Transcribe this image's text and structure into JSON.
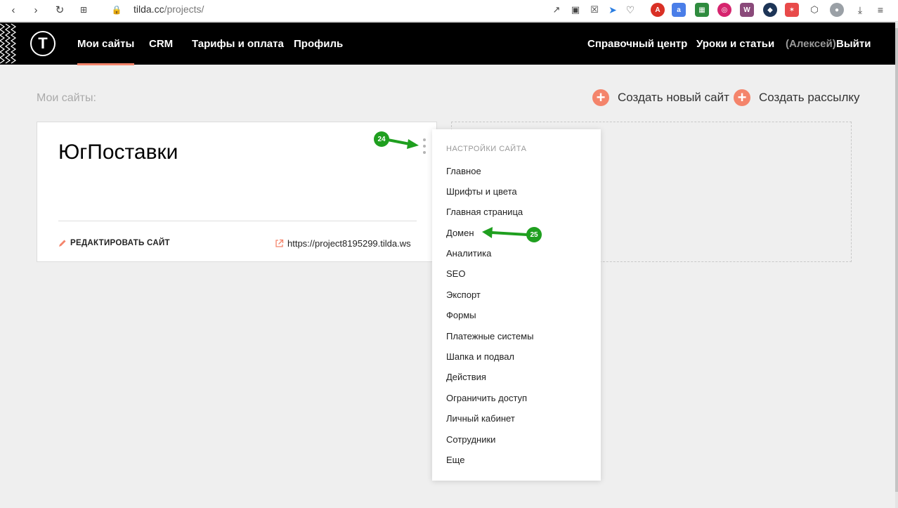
{
  "browser": {
    "url_host": "tilda.cc",
    "url_path": "/projects/"
  },
  "nav": {
    "left": [
      {
        "label": "Мои сайты",
        "active": true
      },
      {
        "label": "CRM",
        "active": false
      },
      {
        "label": "Тарифы и оплата",
        "active": false
      },
      {
        "label": "Профиль",
        "active": false
      }
    ],
    "help": "Справочный центр",
    "lessons": "Уроки и статьи",
    "user": "(Алексей)",
    "logout": "Выйти"
  },
  "page": {
    "title": "Мои сайты:",
    "create_site": "Создать новый сайт",
    "create_mailing": "Создать рассылку"
  },
  "site_card": {
    "name": "ЮгПоставки",
    "edit_label": "РЕДАКТИРОВАТЬ САЙТ",
    "url": "https://project8195299.tilda.ws"
  },
  "settings_menu": {
    "header": "НАСТРОЙКИ САЙТА",
    "items": [
      "Главное",
      "Шрифты и цвета",
      "Главная страница",
      "Домен",
      "Аналитика",
      "SEO",
      "Экспорт",
      "Формы",
      "Платежные системы",
      "Шапка и подвал",
      "Действия",
      "Ограничить доступ",
      "Личный кабинет",
      "Сотрудники",
      "Еще"
    ]
  },
  "annotations": {
    "marker_1": "24",
    "marker_2": "25",
    "color": "#1f9f1f"
  },
  "colors": {
    "accent": "#f4846b",
    "header_bg": "#000000",
    "page_bg": "#efefef"
  }
}
